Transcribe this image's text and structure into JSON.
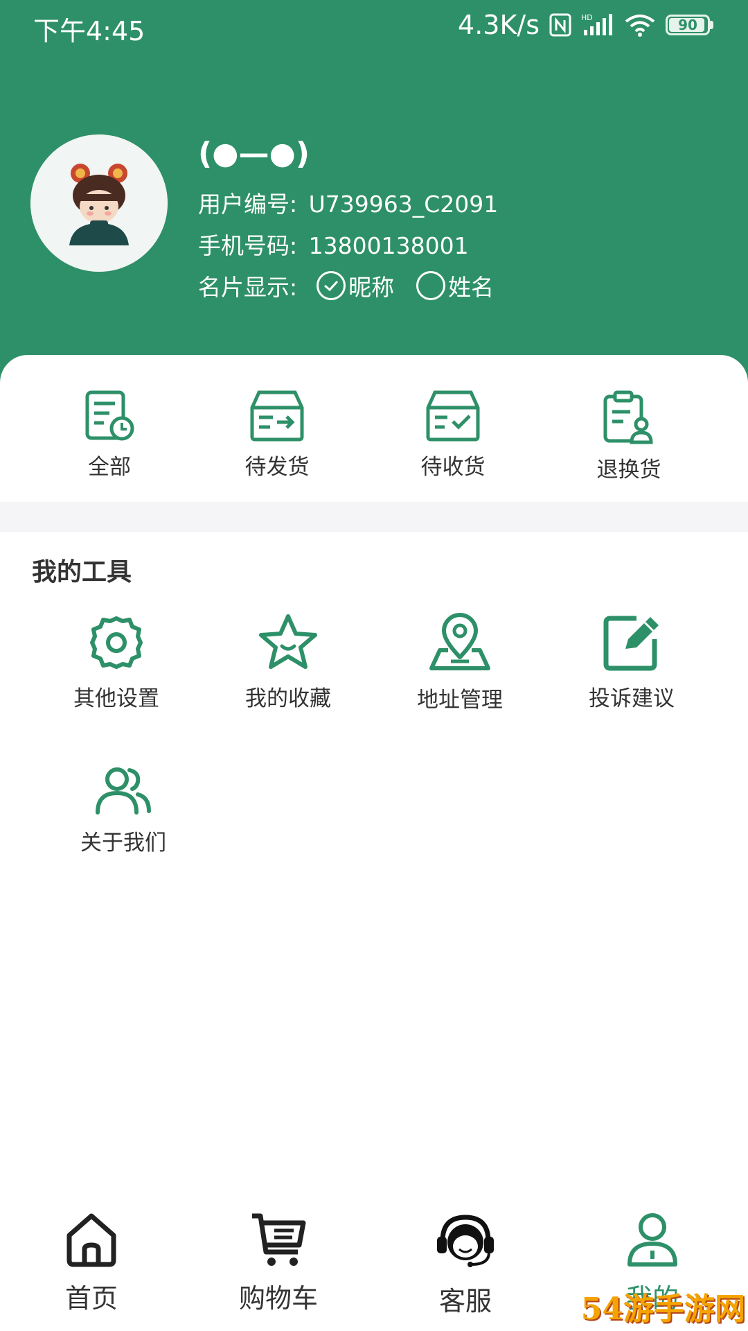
{
  "status_bar": {
    "time": "下午4:45",
    "network_speed": "4.3K/s",
    "battery": "90",
    "icons": [
      "nfc-icon",
      "signal-icon",
      "wifi-icon",
      "battery-icon"
    ]
  },
  "profile": {
    "nickname": "(●—●)",
    "user_id_label": "用户编号:",
    "user_id": "U739963_C2091",
    "phone_label": "手机号码:",
    "phone": "13800138001",
    "card_display_label": "名片显示:",
    "options": [
      {
        "label": "昵称",
        "checked": true
      },
      {
        "label": "姓名",
        "checked": false
      }
    ]
  },
  "orders": [
    {
      "label": "全部",
      "icon": "order-all-icon"
    },
    {
      "label": "待发货",
      "icon": "to-ship-icon"
    },
    {
      "label": "待收货",
      "icon": "to-receive-icon"
    },
    {
      "label": "退换货",
      "icon": "return-exchange-icon"
    }
  ],
  "tools": {
    "title": "我的工具",
    "items": [
      {
        "label": "其他设置",
        "icon": "gear-icon"
      },
      {
        "label": "我的收藏",
        "icon": "star-icon"
      },
      {
        "label": "地址管理",
        "icon": "location-icon"
      },
      {
        "label": "投诉建议",
        "icon": "edit-icon"
      },
      {
        "label": "关于我们",
        "icon": "users-icon"
      }
    ]
  },
  "bottom_nav": [
    {
      "label": "首页",
      "icon": "home-icon",
      "active": false
    },
    {
      "label": "购物车",
      "icon": "cart-icon",
      "active": false
    },
    {
      "label": "客服",
      "icon": "customer-service-icon",
      "active": false
    },
    {
      "label": "我的",
      "icon": "user-icon",
      "active": true
    }
  ],
  "colors": {
    "brand_green": "#2e9068",
    "text_dark": "#333333",
    "band_gray": "#f5f5f7"
  },
  "watermark": "54游手游网"
}
